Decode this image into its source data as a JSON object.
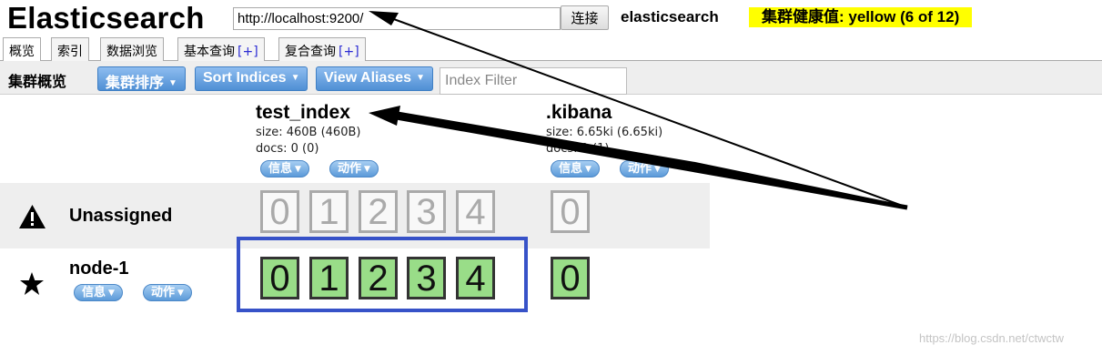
{
  "header": {
    "app_title": "Elasticsearch",
    "url_value": "http://localhost:9200/",
    "connect_label": "连接",
    "cluster_name": "elasticsearch",
    "health_text": "集群健康值: yellow (6 of 12)",
    "health_color": "#ffff00"
  },
  "tabs": [
    {
      "label": "概览",
      "plus": ""
    },
    {
      "label": "索引",
      "plus": ""
    },
    {
      "label": "数据浏览",
      "plus": ""
    },
    {
      "label": "基本查询",
      "plus": "[+]"
    },
    {
      "label": "复合查询",
      "plus": "[+]"
    }
  ],
  "toolbar": {
    "title": "集群概览",
    "cluster_sort_label": "集群排序",
    "sort_indices_label": "Sort Indices",
    "view_aliases_label": "View Aliases",
    "index_filter_placeholder": "Index Filter"
  },
  "indices": [
    {
      "name": "test_index",
      "size": "size: 460B (460B)",
      "docs": "docs: 0 (0)",
      "info_label": "信息",
      "action_label": "动作"
    },
    {
      "name": ".kibana",
      "size": "size: 6.65ki (6.65ki)",
      "docs": "docs: 1 (1)",
      "info_label": "信息",
      "action_label": "动作"
    }
  ],
  "unassigned": {
    "label": "Unassigned",
    "icon": "warning-icon",
    "test_index_shards": [
      "0",
      "1",
      "2",
      "3",
      "4"
    ],
    "kibana_shards": [
      "0"
    ]
  },
  "node": {
    "label": "node-1",
    "icon": "star-icon",
    "info_label": "信息",
    "action_label": "动作",
    "test_index_shards": [
      "0",
      "1",
      "2",
      "3",
      "4"
    ],
    "kibana_shards": [
      "0"
    ]
  },
  "colors": {
    "assigned_shard": "#99dd88",
    "highlight": "#3752c8",
    "button_blue": "#4f8fd4"
  },
  "watermark": "https://blog.csdn.net/ctwctw"
}
